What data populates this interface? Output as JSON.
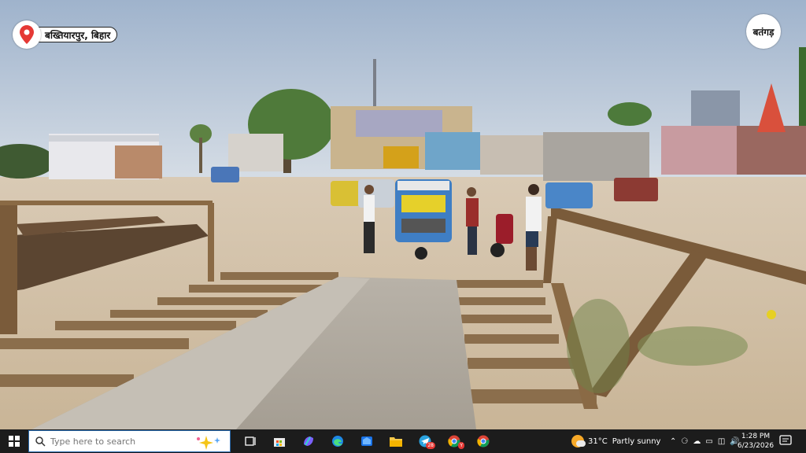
{
  "overlay": {
    "location": "बख्तियारपुर, बिहार",
    "brand": "बतंगड़",
    "pin_icon": "location-pin-icon"
  },
  "taskbar": {
    "search_placeholder": "Type here to search",
    "apps": [
      {
        "name": "task-view-icon"
      },
      {
        "name": "store-icon"
      },
      {
        "name": "copilot-icon"
      },
      {
        "name": "edge-icon"
      },
      {
        "name": "outlook-icon"
      },
      {
        "name": "file-explorer-icon"
      },
      {
        "name": "telegram-icon",
        "badge": "28"
      },
      {
        "name": "chrome-icon",
        "badge": "Y"
      },
      {
        "name": "chrome-profile-icon"
      }
    ],
    "weather": {
      "temp": "31°C",
      "condition": "Partly sunny"
    },
    "clock": {
      "time": "1:28 PM",
      "date": "6/23/2026"
    }
  },
  "colors": {
    "taskbar_bg": "#1c1c1c",
    "pin_red": "#e53935",
    "sky": "#b9cbe0",
    "sand": "#d8c7ae"
  }
}
